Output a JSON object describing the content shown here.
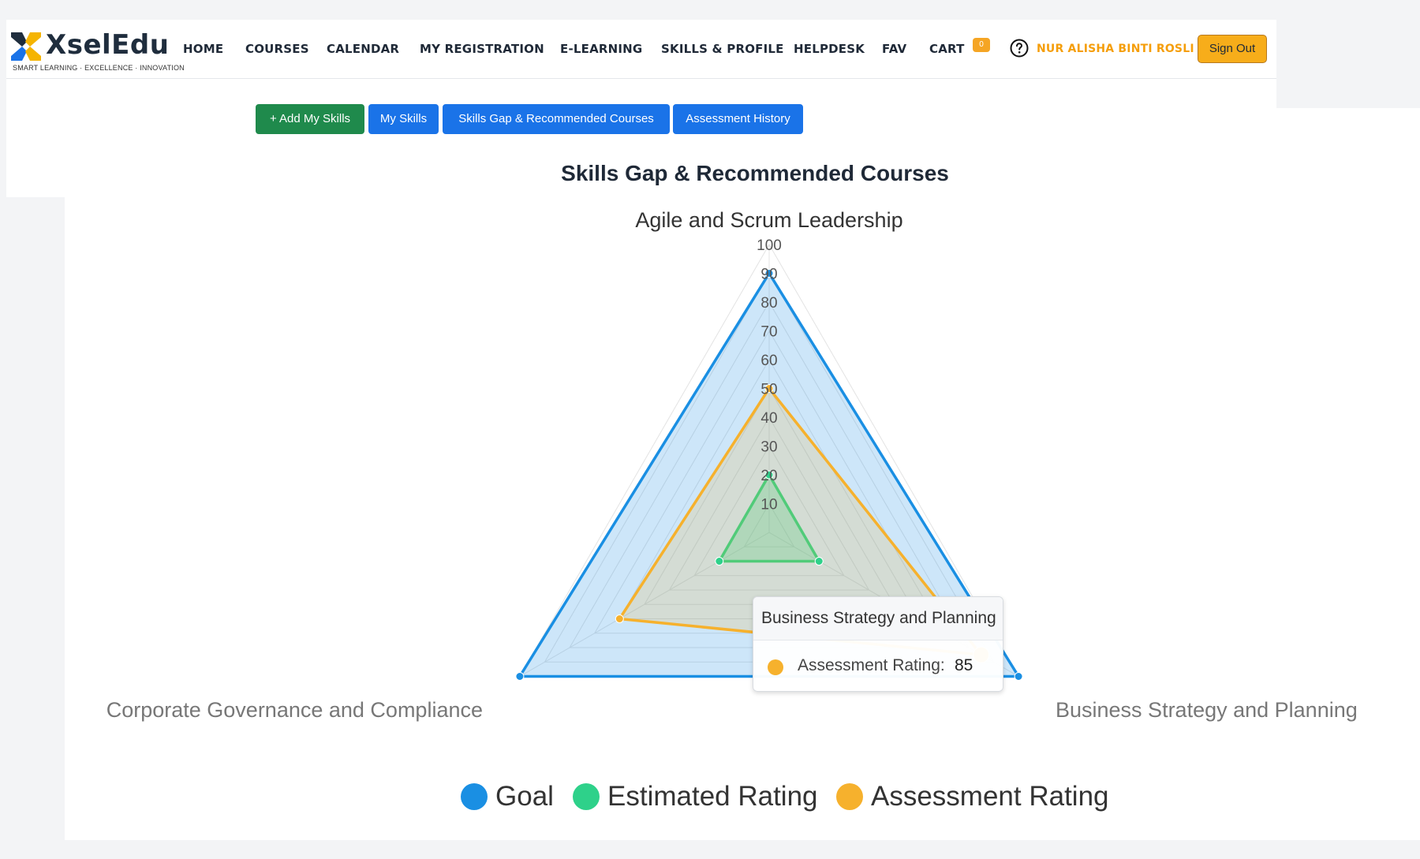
{
  "brand": {
    "name": "XselEdu",
    "tagline": "SMART LEARNING · EXCELLENCE · INNOVATION",
    "colors": {
      "navy": "#1f2d3d",
      "yellow": "#f5b400",
      "blue": "#1a73e8"
    }
  },
  "nav": {
    "items": [
      {
        "label": "HOME"
      },
      {
        "label": "COURSES"
      },
      {
        "label": "CALENDAR"
      },
      {
        "label": "MY REGISTRATION"
      },
      {
        "label": "E-LEARNING"
      },
      {
        "label": "SKILLS & PROFILE"
      },
      {
        "label": "HELPDESK"
      },
      {
        "label": "FAV"
      },
      {
        "label": "CART"
      }
    ],
    "cart_count": "0",
    "help_icon": "question-circle-icon",
    "user_name": "NUR ALISHA BINTI ROSLI",
    "sign_out_label": "Sign Out"
  },
  "actions": {
    "add_skills": "+ Add My Skills",
    "my_skills": "My Skills",
    "skills_gap": "Skills Gap & Recommended Courses",
    "assessment_history": "Assessment History"
  },
  "page_title": "Skills Gap & Recommended Courses",
  "chart_data": {
    "type": "radar",
    "title": "Skills Gap & Recommended Courses",
    "axes": [
      "Agile and Scrum Leadership",
      "Business Strategy and Planning",
      "Corporate Governance and Compliance"
    ],
    "scale": {
      "min": 0,
      "max": 100,
      "step": 10
    },
    "tick_labels": [
      "10",
      "20",
      "30",
      "40",
      "50",
      "60",
      "70",
      "80",
      "90",
      "100"
    ],
    "series": [
      {
        "name": "Goal",
        "color": "#1a8fe3",
        "values": [
          90,
          100,
          100
        ]
      },
      {
        "name": "Estimated Rating",
        "color": "#2ed18a",
        "values": [
          20,
          20,
          20
        ]
      },
      {
        "name": "Assessment Rating",
        "color": "#f6b12d",
        "values": [
          50,
          85,
          60
        ]
      }
    ],
    "legend_position": "bottom",
    "grid": true
  },
  "tooltip": {
    "title": "Business Strategy and Planning",
    "series_label": "Assessment Rating:",
    "value": "85",
    "color": "#f6b12d"
  }
}
